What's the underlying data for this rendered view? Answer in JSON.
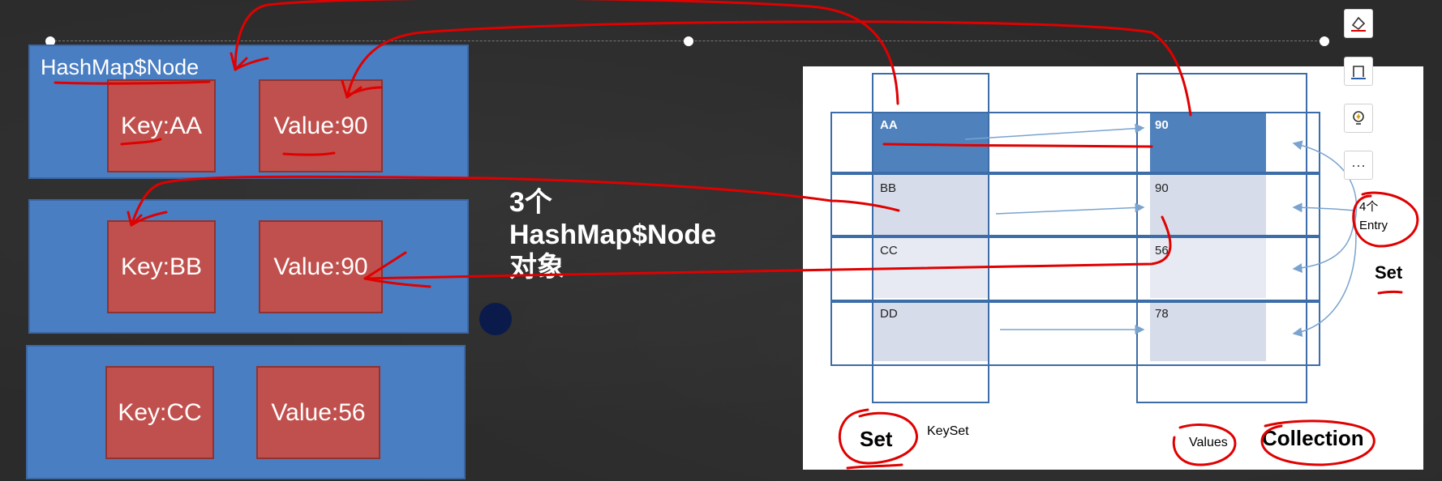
{
  "left": {
    "node_title": "HashMap$Node",
    "nodes": [
      {
        "key": "Key:AA",
        "value": "Value:90"
      },
      {
        "key": "Key:BB",
        "value": "Value:90"
      },
      {
        "key": "Key:CC",
        "value": "Value:56"
      }
    ]
  },
  "center": {
    "line1": "3个",
    "line2": "HashMap$Node",
    "line3": "对象"
  },
  "slide": {
    "keys": [
      "AA",
      "BB",
      "CC",
      "DD"
    ],
    "values": [
      "90",
      "90",
      "56",
      "78"
    ],
    "entry_count": "4个",
    "entry_label": "Entry",
    "set_right": "Set",
    "set_bottom": "Set",
    "keyset_label": "KeySet",
    "values_label": "Values",
    "collection_label": "Collection"
  },
  "colors": {
    "panel_blue": "#4a7ec2",
    "node_red": "#c0504d",
    "ink_red": "#e00000",
    "highlight_blue": "#4f81bd",
    "light_cell": "#d6dcea"
  },
  "toolbar": {
    "icons": [
      "eraser-icon",
      "frame-icon",
      "lightbulb-icon",
      "more-icon"
    ],
    "more_label": "···"
  }
}
